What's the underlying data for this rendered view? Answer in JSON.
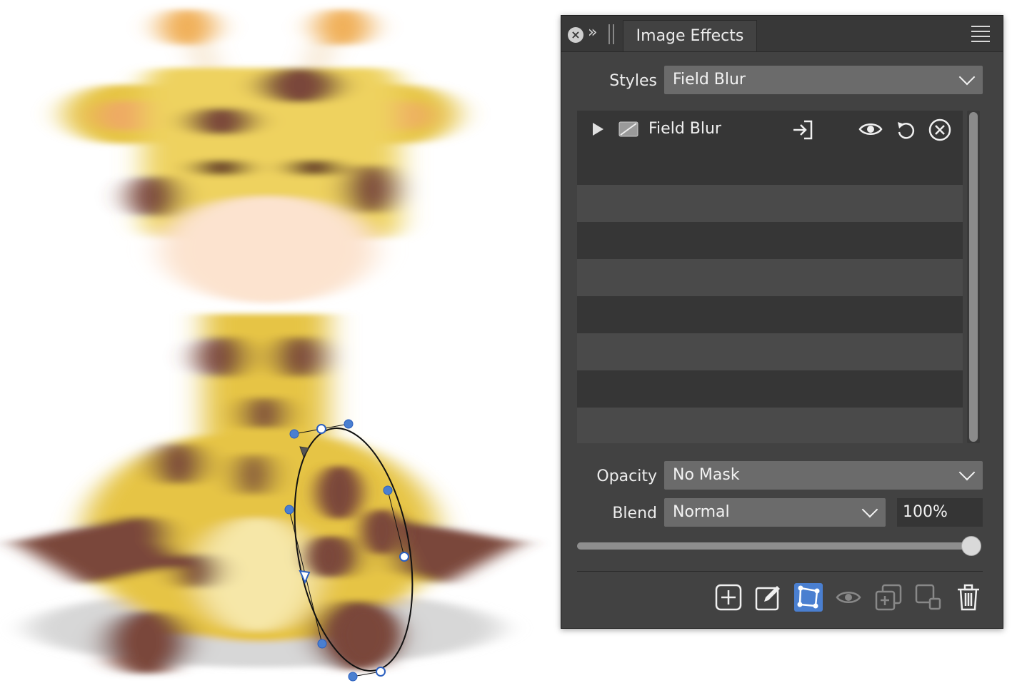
{
  "panel": {
    "title": "Image Effects",
    "styles_label": "Styles",
    "styles_value": "Field Blur",
    "effect": {
      "name": "Field Blur"
    },
    "opacity_label": "Opacity",
    "opacity_value": "No Mask",
    "blend_label": "Blend",
    "blend_value": "Normal",
    "opacity_percent": "100%",
    "opacity_level": 1.0
  },
  "icons": {
    "close": "close-icon",
    "collapse": "double-chevron-right-icon",
    "menu": "hamburger-menu-icon",
    "expand": "triangle-right-icon",
    "effect_thumb": "layer-thumbnail-icon",
    "export": "export-arrow-icon",
    "visibility": "eye-icon",
    "reset": "reset-icon",
    "remove": "remove-circle-icon",
    "tools": [
      "add-icon",
      "edit-icon",
      "mask-shape-icon",
      "eye-icon",
      "duplicate-icon",
      "merge-icon",
      "trash-icon"
    ]
  },
  "colors": {
    "panel_bg": "#424242",
    "accent_blue": "#4a7fd0",
    "giraffe_yellow": "#e6c445",
    "giraffe_spot": "#7a463a"
  }
}
